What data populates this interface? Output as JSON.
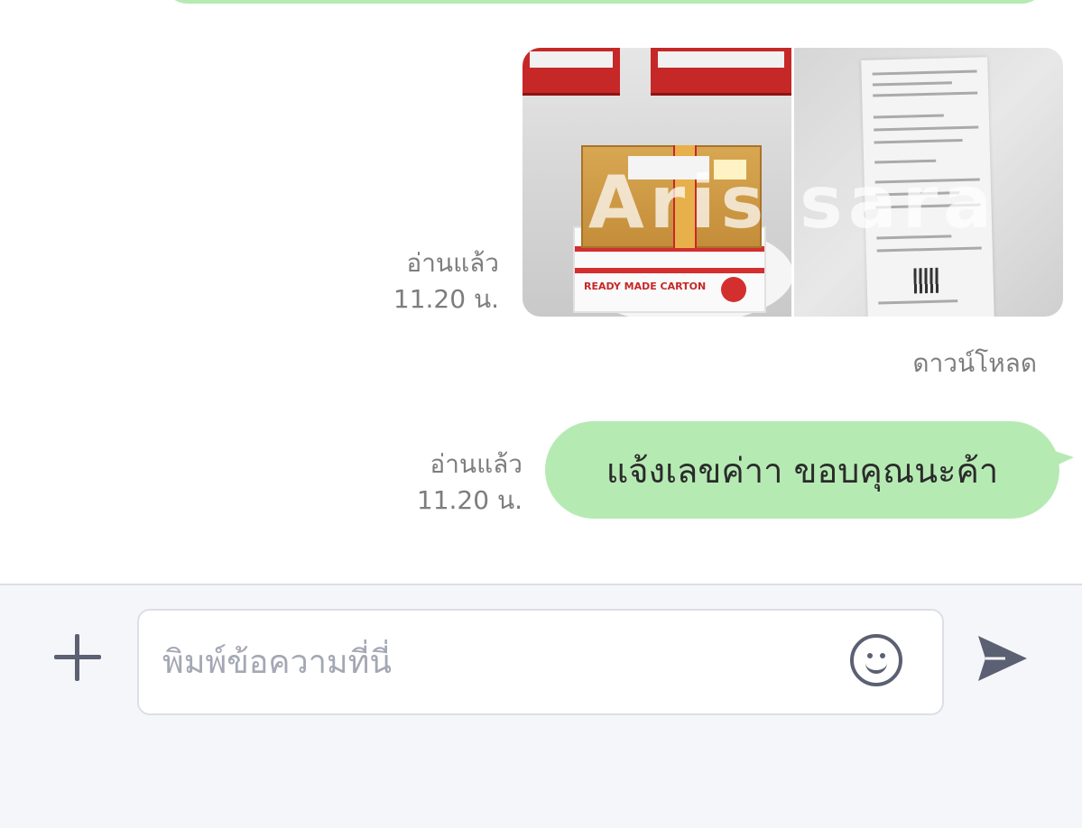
{
  "conversation": {
    "image_message": {
      "read_status": "อ่านแล้ว",
      "time": "11.20 น.",
      "watermark": "Aris sara",
      "carton_label": "READY MADE CARTON",
      "download_label": "ดาวน์โหลด"
    },
    "text_message": {
      "read_status": "อ่านแล้ว",
      "time": "11.20 น.",
      "text": "แจ้งเลขค่าา ขอบคุณนะค้า"
    }
  },
  "composer": {
    "placeholder": "พิมพ์ข้อความที่นี่",
    "plus_icon": "plus-icon",
    "emoji_icon": "smiley-icon",
    "send_icon": "send-icon"
  },
  "colors": {
    "bubble": "#b6eab3",
    "composer_bg": "#f5f6f9",
    "icon": "#5b6073",
    "meta_text": "#7d7d7d",
    "placeholder": "#a4a8b4"
  }
}
